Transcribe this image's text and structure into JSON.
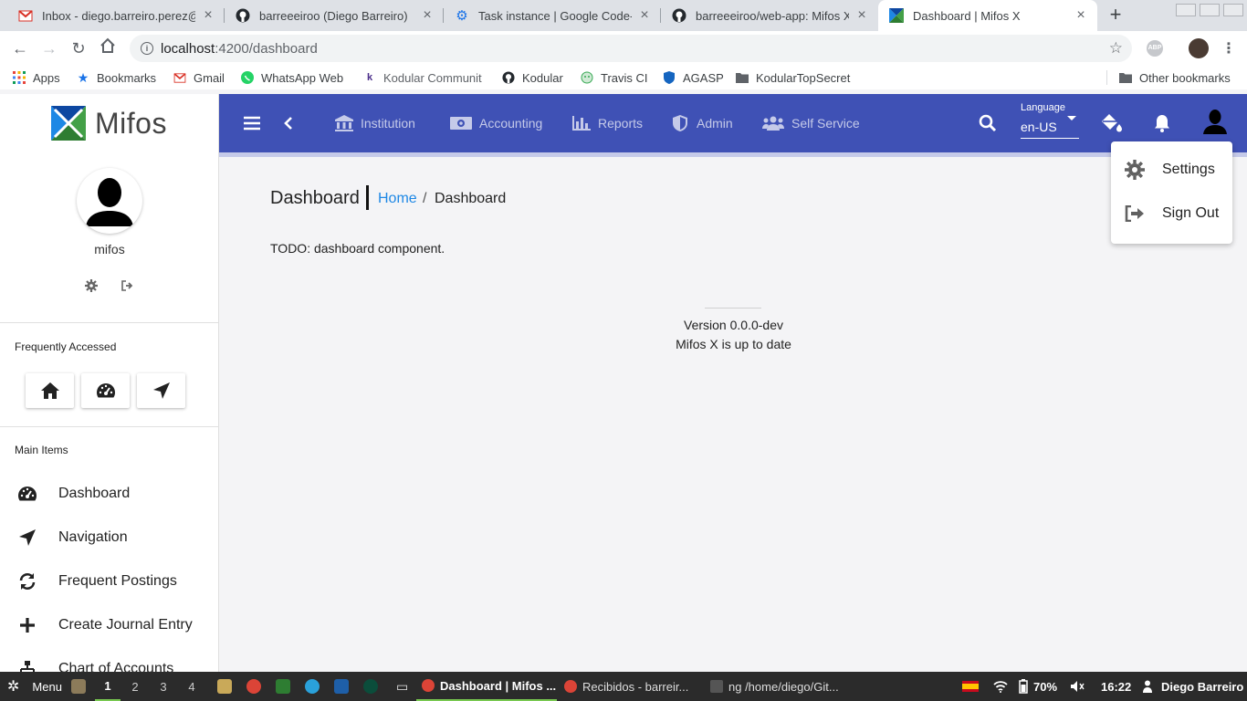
{
  "browser": {
    "tabs": [
      {
        "title": "Inbox - diego.barreiro.perez@",
        "icon": "gmail-icon",
        "badge": "0"
      },
      {
        "title": "barreeeiroo (Diego Barreiro)",
        "icon": "github-icon"
      },
      {
        "title": "Task instance | Google Code-i",
        "icon": "gear-icon"
      },
      {
        "title": "barreeeiroo/web-app: Mifos X",
        "icon": "github-icon"
      },
      {
        "title": "Dashboard | Mifos X",
        "icon": "mifos-icon"
      }
    ],
    "url_host": "localhost",
    "url_path": ":4200/dashboard",
    "abp_label": "ABP",
    "bookmarks": [
      {
        "label": "Apps",
        "icon": "apps-grid-icon"
      },
      {
        "label": "Bookmarks",
        "icon": "star-icon"
      },
      {
        "label": "Gmail",
        "icon": "gmail-icon"
      },
      {
        "label": "WhatsApp Web",
        "icon": "whatsapp-icon"
      },
      {
        "label": "Kodular Communit",
        "icon": "kodular-k-icon"
      },
      {
        "label": "Kodular",
        "icon": "github-icon"
      },
      {
        "label": "Travis CI",
        "icon": "travis-icon"
      },
      {
        "label": "AGASP",
        "icon": "shield-icon"
      },
      {
        "label": "KodularTopSecret",
        "icon": "folder-icon"
      }
    ],
    "other_bookmarks": "Other bookmarks"
  },
  "sidebar": {
    "brand": "Mifos",
    "user_name": "mifos",
    "frequently_accessed_title": "Frequently Accessed",
    "main_items_title": "Main Items",
    "main_items": [
      {
        "label": "Dashboard",
        "icon": "dashboard-gauge-icon"
      },
      {
        "label": "Navigation",
        "icon": "location-arrow-icon"
      },
      {
        "label": "Frequent Postings",
        "icon": "sync-icon"
      },
      {
        "label": "Create Journal Entry",
        "icon": "plus-icon"
      },
      {
        "label": "Chart of Accounts",
        "icon": "sitemap-icon"
      }
    ]
  },
  "topbar": {
    "menu": [
      {
        "label": "Institution",
        "icon": "university-icon"
      },
      {
        "label": "Accounting",
        "icon": "money-bill-icon"
      },
      {
        "label": "Reports",
        "icon": "chart-bar-icon"
      },
      {
        "label": "Admin",
        "icon": "shield-icon"
      },
      {
        "label": "Self Service",
        "icon": "users-icon"
      }
    ],
    "language_label": "Language",
    "language_value": "en-US"
  },
  "user_menu": {
    "settings": "Settings",
    "sign_out": "Sign Out"
  },
  "content": {
    "title": "Dashboard",
    "breadcrumb_home": "Home",
    "breadcrumb_sep": "/",
    "breadcrumb_current": "Dashboard",
    "todo": "TODO: dashboard component.",
    "version": "Version 0.0.0-dev",
    "status": "Mifos X is up to date"
  },
  "taskbar": {
    "menu_label": "Menu",
    "workspaces": [
      "1",
      "2",
      "3",
      "4"
    ],
    "tasks": [
      {
        "label": "Dashboard | Mifos ...",
        "active": true
      },
      {
        "label": "Recibidos - barreir..."
      },
      {
        "label": "ng  /home/diego/Git..."
      }
    ],
    "battery": "70%",
    "time": "16:22",
    "user": "Diego Barreiro"
  },
  "colors": {
    "appbar": "#3f51b5",
    "link": "#1e88e5",
    "taskbar_active": "#78c850"
  }
}
